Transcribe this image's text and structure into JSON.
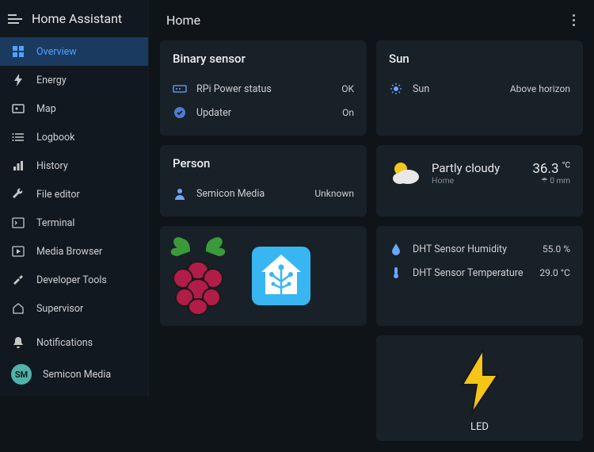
{
  "app_title": "Home Assistant",
  "page_title": "Home",
  "sidebar": {
    "items": [
      {
        "label": "Overview",
        "icon": "dashboard-icon",
        "active": true
      },
      {
        "label": "Energy",
        "icon": "bolt-icon"
      },
      {
        "label": "Map",
        "icon": "map-icon"
      },
      {
        "label": "Logbook",
        "icon": "list-icon"
      },
      {
        "label": "History",
        "icon": "chart-icon"
      },
      {
        "label": "File editor",
        "icon": "wrench-icon"
      },
      {
        "label": "Terminal",
        "icon": "terminal-icon"
      },
      {
        "label": "Media Browser",
        "icon": "play-icon"
      },
      {
        "label": "Developer Tools",
        "icon": "hammer-icon"
      },
      {
        "label": "Supervisor",
        "icon": "ha-icon"
      }
    ],
    "notifications_label": "Notifications",
    "user": {
      "name": "Semicon Media",
      "initials": "SM"
    }
  },
  "cards": {
    "binary_sensor": {
      "title": "Binary sensor",
      "rows": [
        {
          "icon": "rpi-icon",
          "label": "RPi Power status",
          "value": "OK"
        },
        {
          "icon": "check-circle-icon",
          "label": "Updater",
          "value": "On"
        }
      ]
    },
    "sun": {
      "title": "Sun",
      "rows": [
        {
          "icon": "sun-icon",
          "label": "Sun",
          "value": "Above horizon"
        }
      ]
    },
    "weather": {
      "condition": "Partly cloudy",
      "location": "Home",
      "temp": "36.3",
      "temp_unit": "°C",
      "precip": "0 mm"
    },
    "person": {
      "title": "Person",
      "rows": [
        {
          "icon": "person-icon",
          "label": "Semicon Media",
          "value": "Unknown"
        }
      ]
    },
    "sensors": {
      "rows": [
        {
          "icon": "water-drop-icon",
          "label": "DHT Sensor Humidity",
          "value": "55.0 %"
        },
        {
          "icon": "thermometer-icon",
          "label": "DHT Sensor Temperature",
          "value": "29.0 °C"
        }
      ]
    },
    "led": {
      "label": "LED"
    }
  },
  "colors": {
    "accent": "#4da3ff",
    "card_bg": "#182028",
    "bolt": "#f5c518"
  }
}
